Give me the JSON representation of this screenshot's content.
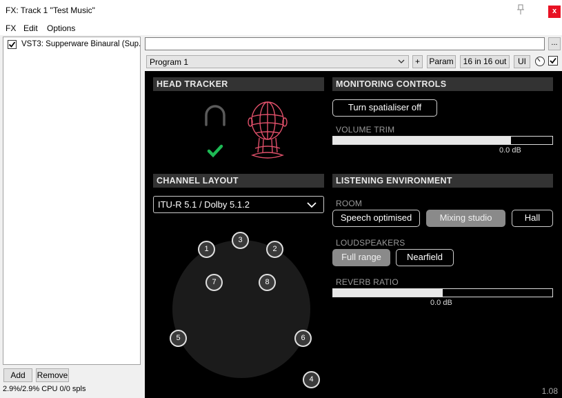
{
  "window": {
    "title": "FX: Track 1 \"Test Music\"",
    "close_label": "x"
  },
  "menu": [
    "FX",
    "Edit",
    "Options"
  ],
  "fx_chain": {
    "items": [
      {
        "label": "VST3: Supperware Binaural (Sup...",
        "enabled": true
      }
    ],
    "add_label": "Add",
    "remove_label": "Remove",
    "cpu_status": "2.9%/2.9% CPU 0/0 spls"
  },
  "toolbar": {
    "preset_value": "",
    "dots_label": "...",
    "program": "Program 1",
    "plus_label": "+",
    "param_label": "Param",
    "io_label": "16 in 16 out",
    "ui_label": "UI"
  },
  "plugin": {
    "head_tracker": {
      "title": "HEAD TRACKER",
      "connected": true
    },
    "monitoring": {
      "title": "MONITORING CONTROLS",
      "spatialiser_button": "Turn spatialiser off",
      "volume_label": "VOLUME TRIM",
      "volume_value": "0.0 dB",
      "volume_fill": 0.81
    },
    "channel_layout": {
      "title": "CHANNEL LAYOUT",
      "selected": "ITU-R 5.1 / Dolby 5.1.2",
      "speakers": [
        "1",
        "2",
        "3",
        "4",
        "5",
        "6",
        "7",
        "8"
      ]
    },
    "listening": {
      "title": "LISTENING ENVIRONMENT",
      "room_label": "ROOM",
      "rooms": [
        "Speech optimised",
        "Mixing studio",
        "Hall"
      ],
      "room_selected": "Mixing studio",
      "loudspeakers_label": "LOUDSPEAKERS",
      "loudspeakers": [
        "Full range",
        "Nearfield"
      ],
      "loudspeakers_selected": "Full range",
      "reverb_label": "REVERB RATIO",
      "reverb_value": "0.0 dB",
      "reverb_fill": 0.5
    },
    "version": "1.08"
  },
  "colors": {
    "accent_check": "#1db954",
    "head_outline": "#e0506a",
    "close_red": "#e81123"
  }
}
